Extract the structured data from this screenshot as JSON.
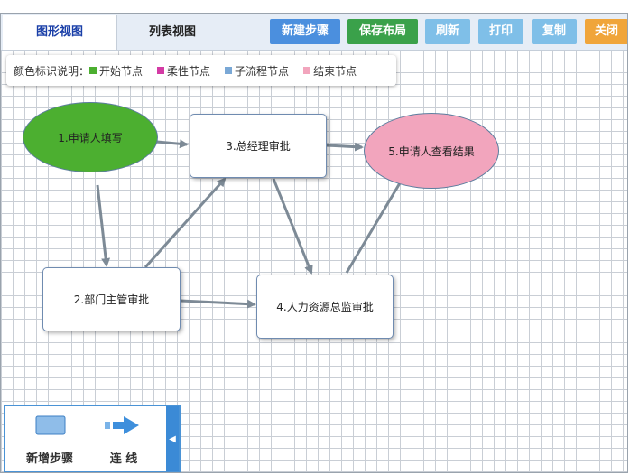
{
  "tabs": [
    {
      "label": "图形视图",
      "active": true
    },
    {
      "label": "列表视图",
      "active": false
    }
  ],
  "toolbar": {
    "new_step": "新建步骤",
    "save_layout": "保存布局",
    "refresh": "刷新",
    "print": "打印",
    "copy": "复制",
    "close": "关闭"
  },
  "colors": {
    "blue_btn": "#4b8fde",
    "green_btn": "#3aa14a",
    "light_btn": "#7fbfe8",
    "orange_btn": "#f0a53a",
    "start": "#4caf30",
    "soft": "#d43ba5",
    "subflow": "#7aa8d6",
    "end": "#f2a5bd"
  },
  "legend": {
    "title": "颜色标识说明：",
    "items": [
      "开始节点",
      "柔性节点",
      "子流程节点",
      "结束节点"
    ]
  },
  "nodes": {
    "n1": "1.申请人填写",
    "n2": "2.部门主管审批",
    "n3": "3.总经理审批",
    "n4": "4.人力资源总监审批",
    "n5": "5.申请人查看结果"
  },
  "toolbox": {
    "add_step": "新增步骤",
    "connect": "连 线",
    "collapse_icon": "chevron-left-icon"
  }
}
